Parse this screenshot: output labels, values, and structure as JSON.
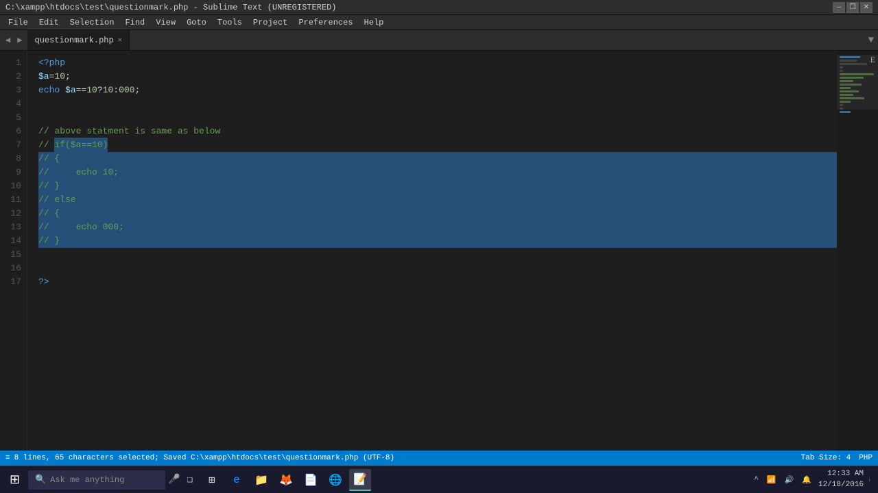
{
  "titlebar": {
    "title": "C:\\xampp\\htdocs\\test\\questionmark.php - Sublime Text (UNREGISTERED)",
    "minimize": "–",
    "maximize": "❐",
    "close": "✕"
  },
  "menubar": {
    "items": [
      "File",
      "Edit",
      "Selection",
      "Find",
      "View",
      "Goto",
      "Tools",
      "Project",
      "Preferences",
      "Help"
    ]
  },
  "tabs": {
    "prev_arrow": "◀",
    "next_arrow": "▶",
    "tab_name": "questionmark.php",
    "tab_close": "✕",
    "scroll_arrow": "▼"
  },
  "code": {
    "lines": [
      {
        "num": "1",
        "content": "<?php",
        "type": "php-open"
      },
      {
        "num": "2",
        "content": "$a=10;",
        "type": "assign"
      },
      {
        "num": "3",
        "content": "echo $a==10?10:000;",
        "type": "echo"
      },
      {
        "num": "4",
        "content": "",
        "type": "empty"
      },
      {
        "num": "5",
        "content": "",
        "type": "empty"
      },
      {
        "num": "6",
        "content": "// above statment is same as below",
        "type": "comment"
      },
      {
        "num": "7",
        "content": "// if($a==10)",
        "type": "comment-sel"
      },
      {
        "num": "8",
        "content": "// {",
        "type": "comment-sel"
      },
      {
        "num": "9",
        "content": "//     echo 10;",
        "type": "comment-sel"
      },
      {
        "num": "10",
        "content": "// }",
        "type": "comment-sel"
      },
      {
        "num": "11",
        "content": "// else",
        "type": "comment-sel"
      },
      {
        "num": "12",
        "content": "// {",
        "type": "comment-sel"
      },
      {
        "num": "13",
        "content": "//     echo 000;",
        "type": "comment-sel"
      },
      {
        "num": "14",
        "content": "// }",
        "type": "comment-sel"
      },
      {
        "num": "15",
        "content": "",
        "type": "empty"
      },
      {
        "num": "16",
        "content": "",
        "type": "empty"
      },
      {
        "num": "17",
        "content": "?>",
        "type": "php-close"
      }
    ]
  },
  "statusbar": {
    "info": "8 lines, 65 characters selected; Saved C:\\xampp\\htdocs\\test\\questionmark.php (UTF-8)",
    "tab_size": "Tab Size: 4",
    "lang": "PHP",
    "icon": "≡"
  },
  "taskbar": {
    "start_icon": "⊞",
    "search_placeholder": "Ask me anything",
    "mic_icon": "🎤",
    "task_view_icon": "❑",
    "time": "12:33 AM",
    "date": "12/18/2016"
  }
}
